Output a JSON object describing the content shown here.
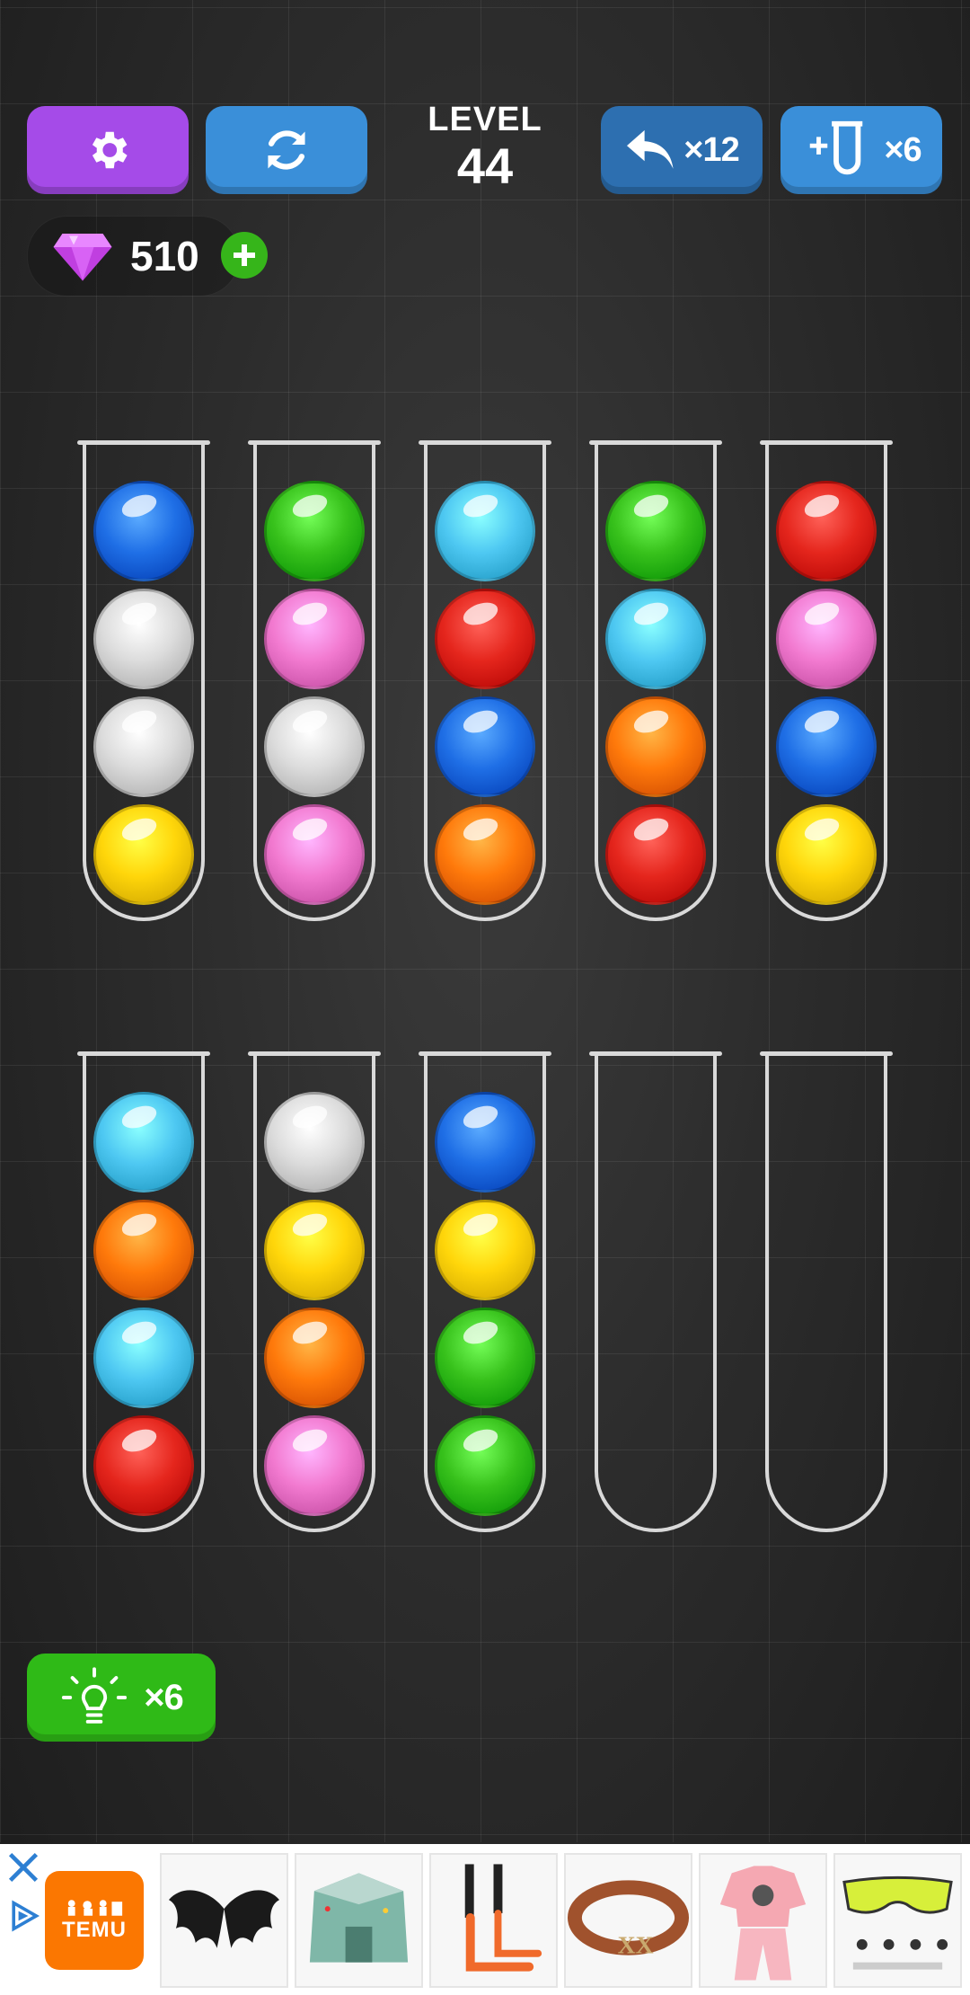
{
  "colors": {
    "blue": "#1f6fe6",
    "white": "#dcdcdc",
    "yellow": "#ffd60a",
    "green": "#38c21c",
    "pink": "#f27ad0",
    "cyan": "#4ec8f2",
    "red": "#e5261d",
    "orange": "#ff7a0b"
  },
  "toolbar": {
    "settings_icon": "gear-icon",
    "restart_icon": "refresh-icon",
    "undo_icon": "undo-arrow-icon",
    "undo_count": "×12",
    "add_tube_icon": "add-tube-icon",
    "add_tube_count": "×6"
  },
  "level": {
    "label": "LEVEL",
    "number": "44"
  },
  "gems": {
    "icon": "diamond-icon",
    "count": "510"
  },
  "tubes_top": [
    [
      "blue",
      "white",
      "white",
      "yellow"
    ],
    [
      "green",
      "pink",
      "white",
      "pink"
    ],
    [
      "cyan",
      "red",
      "blue",
      "orange"
    ],
    [
      "green",
      "cyan",
      "orange",
      "red"
    ],
    [
      "red",
      "pink",
      "blue",
      "yellow"
    ]
  ],
  "tubes_bottom": [
    [
      "cyan",
      "orange",
      "cyan",
      "red"
    ],
    [
      "white",
      "yellow",
      "orange",
      "pink"
    ],
    [
      "blue",
      "yellow",
      "green",
      "green"
    ],
    [],
    []
  ],
  "hint": {
    "icon": "lightbulb-icon",
    "count": "×6"
  },
  "ad": {
    "brand": "TEMU",
    "products": [
      "bat-wings",
      "tent",
      "wall-hooks",
      "leather-belt",
      "kids-outfit",
      "sport-glasses"
    ]
  }
}
